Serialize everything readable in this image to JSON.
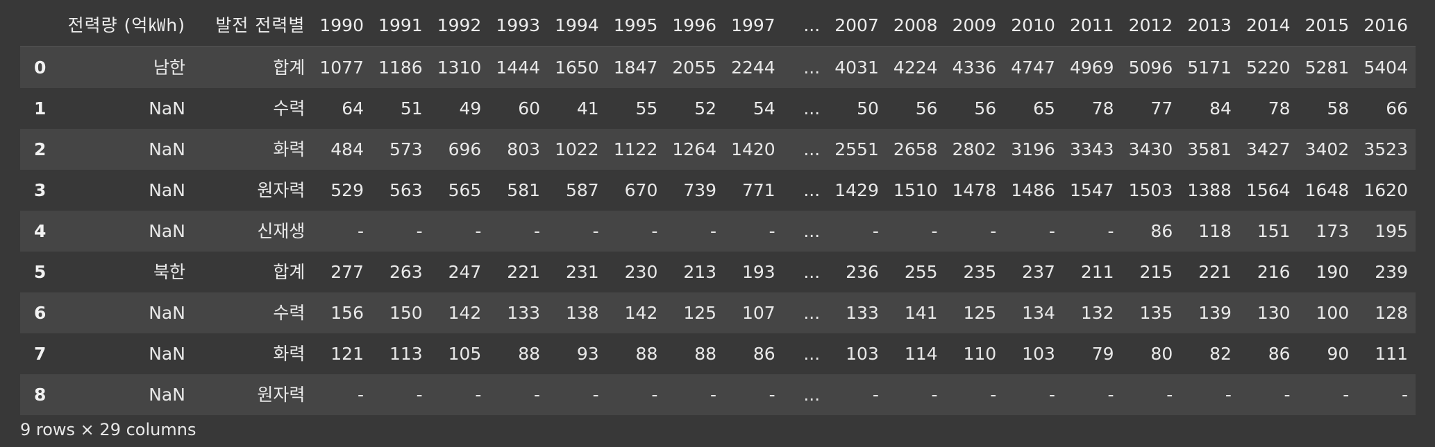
{
  "dataframe": {
    "columns": [
      "전력량 (억㎾h)",
      "발전 전력별",
      "1990",
      "1991",
      "1992",
      "1993",
      "1994",
      "1995",
      "1996",
      "1997",
      "...",
      "2007",
      "2008",
      "2009",
      "2010",
      "2011",
      "2012",
      "2013",
      "2014",
      "2015",
      "2016"
    ],
    "rows": [
      {
        "index": "0",
        "cells": [
          "남한",
          "합계",
          "1077",
          "1186",
          "1310",
          "1444",
          "1650",
          "1847",
          "2055",
          "2244",
          "...",
          "4031",
          "4224",
          "4336",
          "4747",
          "4969",
          "5096",
          "5171",
          "5220",
          "5281",
          "5404"
        ]
      },
      {
        "index": "1",
        "cells": [
          "NaN",
          "수력",
          "64",
          "51",
          "49",
          "60",
          "41",
          "55",
          "52",
          "54",
          "...",
          "50",
          "56",
          "56",
          "65",
          "78",
          "77",
          "84",
          "78",
          "58",
          "66"
        ]
      },
      {
        "index": "2",
        "cells": [
          "NaN",
          "화력",
          "484",
          "573",
          "696",
          "803",
          "1022",
          "1122",
          "1264",
          "1420",
          "...",
          "2551",
          "2658",
          "2802",
          "3196",
          "3343",
          "3430",
          "3581",
          "3427",
          "3402",
          "3523"
        ]
      },
      {
        "index": "3",
        "cells": [
          "NaN",
          "원자력",
          "529",
          "563",
          "565",
          "581",
          "587",
          "670",
          "739",
          "771",
          "...",
          "1429",
          "1510",
          "1478",
          "1486",
          "1547",
          "1503",
          "1388",
          "1564",
          "1648",
          "1620"
        ]
      },
      {
        "index": "4",
        "cells": [
          "NaN",
          "신재생",
          "-",
          "-",
          "-",
          "-",
          "-",
          "-",
          "-",
          "-",
          "...",
          "-",
          "-",
          "-",
          "-",
          "-",
          "86",
          "118",
          "151",
          "173",
          "195"
        ]
      },
      {
        "index": "5",
        "cells": [
          "북한",
          "합계",
          "277",
          "263",
          "247",
          "221",
          "231",
          "230",
          "213",
          "193",
          "...",
          "236",
          "255",
          "235",
          "237",
          "211",
          "215",
          "221",
          "216",
          "190",
          "239"
        ]
      },
      {
        "index": "6",
        "cells": [
          "NaN",
          "수력",
          "156",
          "150",
          "142",
          "133",
          "138",
          "142",
          "125",
          "107",
          "...",
          "133",
          "141",
          "125",
          "134",
          "132",
          "135",
          "139",
          "130",
          "100",
          "128"
        ]
      },
      {
        "index": "7",
        "cells": [
          "NaN",
          "화력",
          "121",
          "113",
          "105",
          "88",
          "93",
          "88",
          "88",
          "86",
          "...",
          "103",
          "114",
          "110",
          "103",
          "79",
          "80",
          "82",
          "86",
          "90",
          "111"
        ]
      },
      {
        "index": "8",
        "cells": [
          "NaN",
          "원자력",
          "-",
          "-",
          "-",
          "-",
          "-",
          "-",
          "-",
          "-",
          "...",
          "-",
          "-",
          "-",
          "-",
          "-",
          "-",
          "-",
          "-",
          "-",
          "-"
        ]
      }
    ],
    "shape_text": "9 rows × 29 columns"
  },
  "colors": {
    "background": "#383838",
    "row_stripe": "#454545",
    "text": "#e8e8e8"
  }
}
